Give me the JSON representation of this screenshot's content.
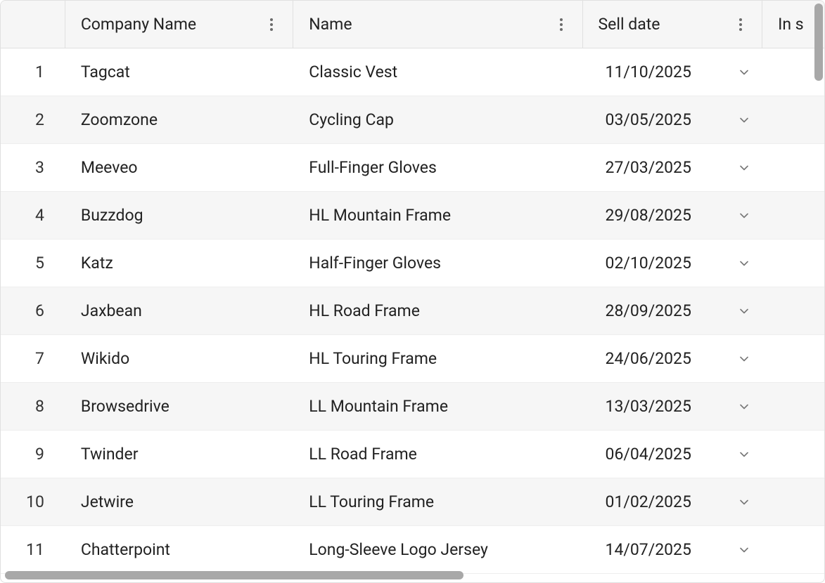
{
  "columns": {
    "company": "Company Name",
    "name": "Name",
    "sell_date": "Sell date",
    "in_stock": "In s"
  },
  "rows": [
    {
      "num": "1",
      "company": "Tagcat",
      "name": "Classic Vest",
      "date": "11/10/2025"
    },
    {
      "num": "2",
      "company": "Zoomzone",
      "name": "Cycling Cap",
      "date": "03/05/2025"
    },
    {
      "num": "3",
      "company": "Meeveo",
      "name": "Full-Finger Gloves",
      "date": "27/03/2025"
    },
    {
      "num": "4",
      "company": "Buzzdog",
      "name": "HL Mountain Frame",
      "date": "29/08/2025"
    },
    {
      "num": "5",
      "company": "Katz",
      "name": "Half-Finger Gloves",
      "date": "02/10/2025"
    },
    {
      "num": "6",
      "company": "Jaxbean",
      "name": "HL Road Frame",
      "date": "28/09/2025"
    },
    {
      "num": "7",
      "company": "Wikido",
      "name": "HL Touring Frame",
      "date": "24/06/2025"
    },
    {
      "num": "8",
      "company": "Browsedrive",
      "name": "LL Mountain Frame",
      "date": "13/03/2025"
    },
    {
      "num": "9",
      "company": "Twinder",
      "name": "LL Road Frame",
      "date": "06/04/2025"
    },
    {
      "num": "10",
      "company": "Jetwire",
      "name": "LL Touring Frame",
      "date": "01/02/2025"
    },
    {
      "num": "11",
      "company": "Chatterpoint",
      "name": "Long-Sleeve Logo Jersey",
      "date": "14/07/2025"
    }
  ]
}
